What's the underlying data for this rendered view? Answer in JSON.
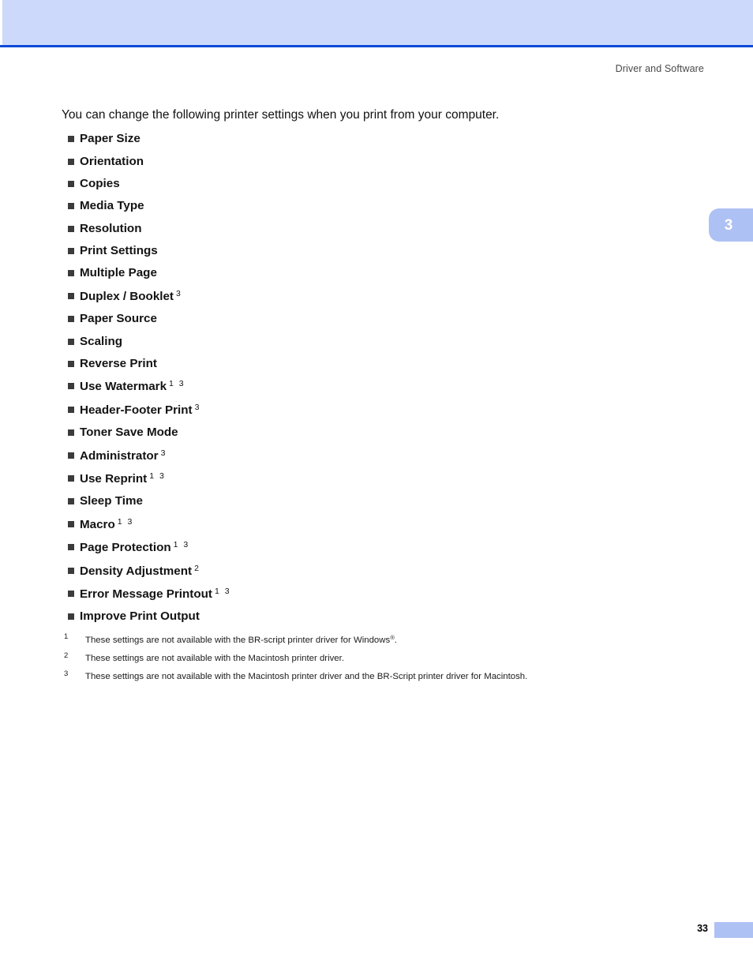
{
  "page": {
    "running_header": "Driver and Software",
    "chapter_tab": "3",
    "page_number": "33"
  },
  "body": {
    "intro": "You can change the following printer settings when you print from your computer.",
    "settings": [
      {
        "label": "Paper Size",
        "marks": ""
      },
      {
        "label": "Orientation",
        "marks": ""
      },
      {
        "label": "Copies",
        "marks": ""
      },
      {
        "label": "Media Type",
        "marks": ""
      },
      {
        "label": "Resolution",
        "marks": ""
      },
      {
        "label": "Print Settings",
        "marks": ""
      },
      {
        "label": "Multiple Page",
        "marks": ""
      },
      {
        "label": "Duplex / Booklet",
        "marks": "3"
      },
      {
        "label": "Paper Source",
        "marks": ""
      },
      {
        "label": "Scaling",
        "marks": ""
      },
      {
        "label": "Reverse Print",
        "marks": ""
      },
      {
        "label": "Use Watermark",
        "marks": "1 3"
      },
      {
        "label": "Header-Footer Print",
        "marks": "3"
      },
      {
        "label": "Toner Save Mode",
        "marks": ""
      },
      {
        "label": "Administrator",
        "marks": "3"
      },
      {
        "label": "Use Reprint",
        "marks": "1 3"
      },
      {
        "label": "Sleep Time",
        "marks": ""
      },
      {
        "label": "Macro",
        "marks": "1 3"
      },
      {
        "label": "Page Protection",
        "marks": "1 3"
      },
      {
        "label": "Density Adjustment",
        "marks": "2"
      },
      {
        "label": "Error Message Printout",
        "marks": "1 3"
      },
      {
        "label": "Improve Print Output",
        "marks": ""
      }
    ],
    "footnotes": [
      {
        "num": "1",
        "text_before": "These settings are not available with the BR-script printer driver for Windows",
        "sup": "®",
        "text_after": "."
      },
      {
        "num": "2",
        "text_before": "These settings are not available with the Macintosh printer driver.",
        "sup": "",
        "text_after": ""
      },
      {
        "num": "3",
        "text_before": "These settings are not available with the Macintosh printer driver and the BR-Script printer driver for Macintosh.",
        "sup": "",
        "text_after": ""
      }
    ]
  },
  "colors": {
    "banner_fill": "#ccd9fa",
    "banner_rule": "#0a4ad8",
    "tab_fill": "#aec1f4",
    "bullet": "#3b3b3b",
    "header_text": "#4a4a4a"
  }
}
